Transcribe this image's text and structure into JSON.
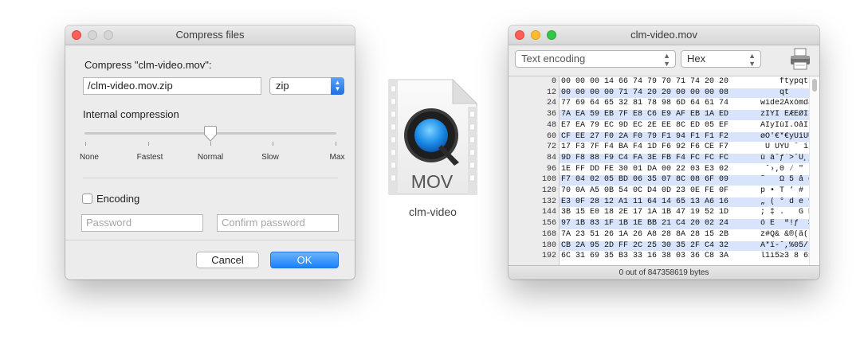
{
  "compress_dialog": {
    "title": "Compress files",
    "heading": "Compress \"clm-video.mov\":",
    "filename_value": "/clm-video.mov.zip",
    "format_value": "zip",
    "compression_label": "Internal compression",
    "compression_levels": [
      "None",
      "Fastest",
      "Normal",
      "Slow",
      "Max"
    ],
    "compression_selected": "Normal",
    "encoding_label": "Encoding",
    "encoding_checked": false,
    "password_placeholder": "Password",
    "confirm_placeholder": "Confirm password",
    "cancel_label": "Cancel",
    "ok_label": "OK"
  },
  "file_icon": {
    "type_label": "MOV",
    "name": "clm-video",
    "icon": "quicktime-icon"
  },
  "hex_window": {
    "title": "clm-video.mov",
    "encoding_value": "Text encoding",
    "mode_value": "Hex",
    "print_icon": "printer-icon",
    "status": "0 out of 847358619 bytes",
    "rows": [
      {
        "offset": "0",
        "hex": "00 00 00 14 66 74 79 70 71 74 20 20",
        "ascii": "    ftypqt  "
      },
      {
        "offset": "12",
        "hex": "00 00 00 00 71 74 20 20 00 00 00 08",
        "ascii": "    qt      "
      },
      {
        "offset": "24",
        "hex": "77 69 64 65 32 81 78 98 6D 64 61 74",
        "ascii": "wide2Åxòmdat"
      },
      {
        "offset": "36",
        "hex": "7A EA 59 EB 7F E8 C6 E9 AF EB 1A ED",
        "ascii": "zÍYÎ ÈÆÉØÎ Ì"
      },
      {
        "offset": "48",
        "hex": "E7 EA 79 EC 9D EC 2E EE 8C ED 05 EF",
        "ascii": "ÁÍyÌùÌ.ÓåÎ Ô"
      },
      {
        "offset": "60",
        "hex": "CF EE 27 F0 2A F0 79 F1 94 F1 F1 F2",
        "ascii": "øÓ'€*€yÚìÚÛÙ"
      },
      {
        "offset": "72",
        "hex": "17 F3 7F F4 BA F4 1D F6 92 F6 CE F7",
        "ascii": " Û ÙŸÙ ˆ í˜Œ˜"
      },
      {
        "offset": "84",
        "hex": "9D F8 88 F9 C4 FA 3E FB F4 FC FC FC",
        "ascii": "ù¯à˘ƒ˙>˚Ù¸¸¸"
      },
      {
        "offset": "96",
        "hex": "1E FF DD FE 30 01 DA 00 22 03 E3 02",
        "ascii": " ˇ›‚0 ⁄ \" „ "
      },
      {
        "offset": "108",
        "hex": "F7 04 02 05 BD 06 35 07 8C 08 6F 09",
        "ascii": "˜   Ω 5 å o "
      },
      {
        "offset": "120",
        "hex": "70 0A A5 0B 54 0C D4 0D 23 0E FE 0F",
        "ascii": "p • T ‘ # ˛ "
      },
      {
        "offset": "132",
        "hex": "E3 0F 28 12 A1 11 64 14 65 13 A6 16",
        "ascii": "„ ( ° d e ¶ "
      },
      {
        "offset": "144",
        "hex": "3B 15 E0 18 2E 17 1A 1B 47 19 52 1D",
        "ascii": "; ‡ .   G R "
      },
      {
        "offset": "156",
        "hex": "97 1B 83 1F 1B 1E BB 21 C4 20 02 24",
        "ascii": "ó É  ª!ƒ  $"
      },
      {
        "offset": "168",
        "hex": "7A 23 51 26 1A 26 A8 28 8A 28 15 2B",
        "ascii": "z#Q& &®(ä( +"
      },
      {
        "offset": "180",
        "hex": "CB 2A 95 2D FF 2C 25 30 35 2F C4 32",
        "ascii": "À*ï-ˇ,%05/ƒ2"
      },
      {
        "offset": "192",
        "hex": "6C 31 69 35 B3 33 16 38 03 36 C8 3A",
        "ascii": "l1i5≥3 8 6»:"
      }
    ]
  }
}
